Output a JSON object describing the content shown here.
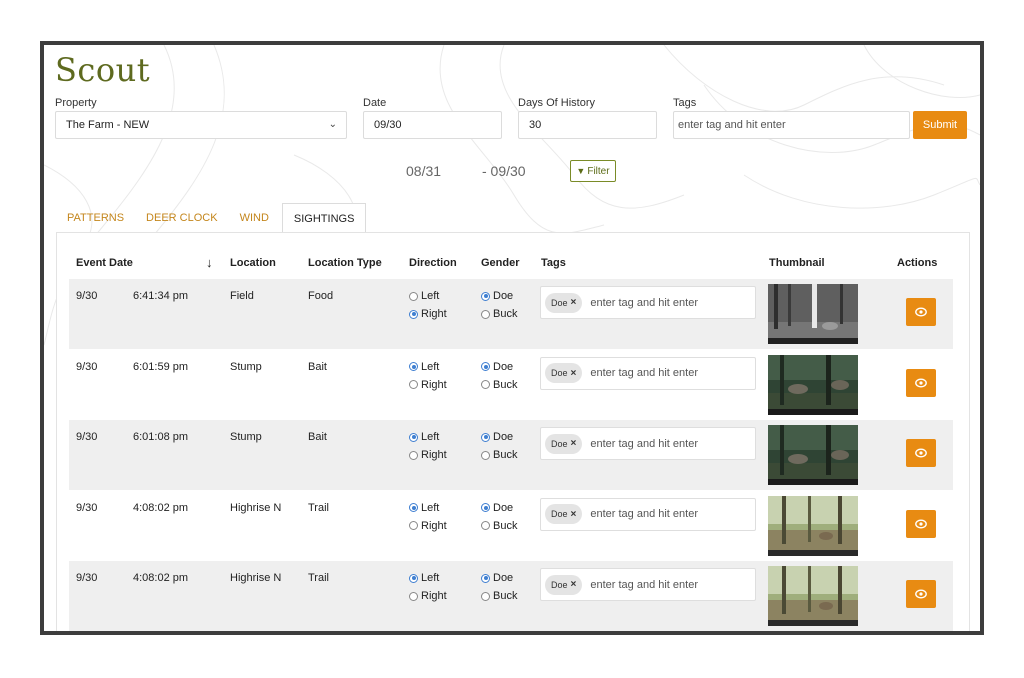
{
  "app": {
    "title": "Scout"
  },
  "filters": {
    "property_label": "Property",
    "property_value": "The Farm - NEW",
    "date_label": "Date",
    "date_value": "09/30",
    "days_label": "Days Of History",
    "days_value": "30",
    "tags_label": "Tags",
    "tags_placeholder": "enter tag and hit enter",
    "submit_label": "Submit",
    "range_start": "08/31",
    "range_end": "- 09/30",
    "filter_label": "Filter"
  },
  "tabs": [
    {
      "label": "PATTERNS",
      "active": false
    },
    {
      "label": "DEER CLOCK",
      "active": false
    },
    {
      "label": "WIND",
      "active": false
    },
    {
      "label": "SIGHTINGS",
      "active": true
    }
  ],
  "table": {
    "columns": [
      "Event Date",
      "Location",
      "Location Type",
      "Direction",
      "Gender",
      "Tags",
      "Thumbnail",
      "Actions"
    ],
    "sort_column": "Event Date",
    "direction_options": [
      "Left",
      "Right"
    ],
    "gender_options": [
      "Doe",
      "Buck"
    ],
    "tag_placeholder": "enter tag and hit enter",
    "rows": [
      {
        "date": "9/30",
        "time": "6:41:34 pm",
        "location": "Field",
        "location_type": "Food",
        "direction": "Right",
        "gender": "Doe",
        "tags": [
          "Doe"
        ],
        "thumbnail": "night-field"
      },
      {
        "date": "9/30",
        "time": "6:01:59 pm",
        "location": "Stump",
        "location_type": "Bait",
        "direction": "Left",
        "gender": "Doe",
        "tags": [
          "Doe"
        ],
        "thumbnail": "dusk-woods"
      },
      {
        "date": "9/30",
        "time": "6:01:08 pm",
        "location": "Stump",
        "location_type": "Bait",
        "direction": "Left",
        "gender": "Doe",
        "tags": [
          "Doe"
        ],
        "thumbnail": "dusk-woods"
      },
      {
        "date": "9/30",
        "time": "4:08:02 pm",
        "location": "Highrise N",
        "location_type": "Trail",
        "direction": "Left",
        "gender": "Doe",
        "tags": [
          "Doe"
        ],
        "thumbnail": "day-woods"
      },
      {
        "date": "9/30",
        "time": "4:08:02 pm",
        "location": "Highrise N",
        "location_type": "Trail",
        "direction": "Left",
        "gender": "Doe",
        "tags": [
          "Doe"
        ],
        "thumbnail": "day-woods"
      }
    ]
  },
  "colors": {
    "accent": "#e88b12",
    "title": "#5e6a1f",
    "tab": "#c4861c",
    "filter": "#7a8b27"
  },
  "icons": {
    "property_select": "chevron-down-icon",
    "filter": "funnel-icon",
    "sort": "arrow-down-icon",
    "tag_remove": "close-icon",
    "view": "eye-icon"
  }
}
